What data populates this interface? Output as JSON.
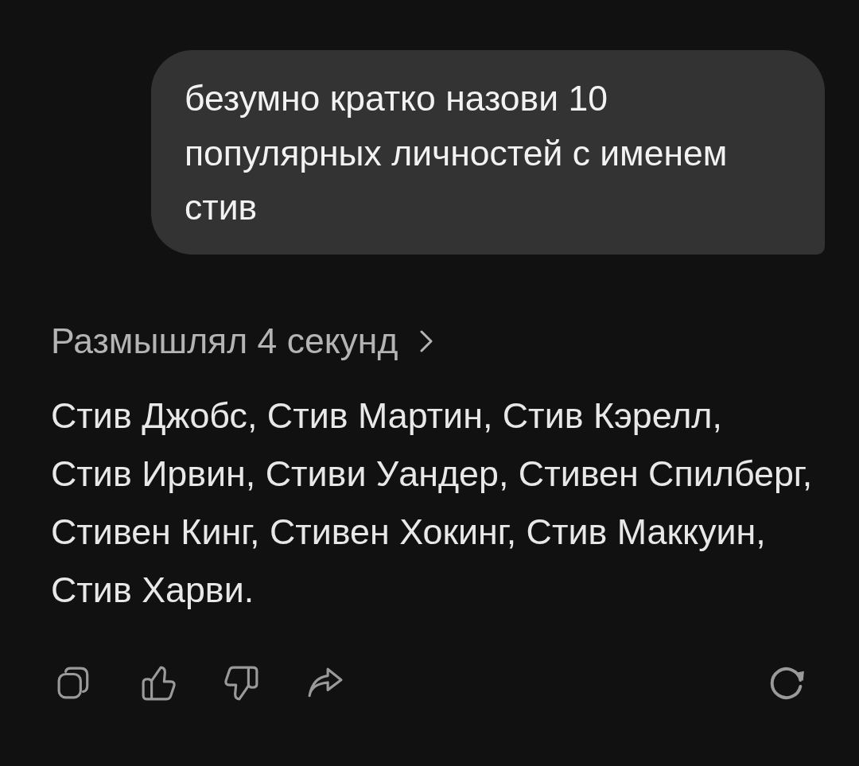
{
  "user_message": {
    "text": "безумно кратко назови 10 популярных личностей с именем стив"
  },
  "reasoning": {
    "label": "Размышлял 4 секунд",
    "expanded": false
  },
  "answer": {
    "text": "Стив Джобс, Стив Мартин, Стив Кэрелл, Стив Ирвин, Стиви Уандер, Стивен Спилберг, Стивен Кинг, Стивен Хокинг, Стив Маккуин, Стив Харви."
  }
}
